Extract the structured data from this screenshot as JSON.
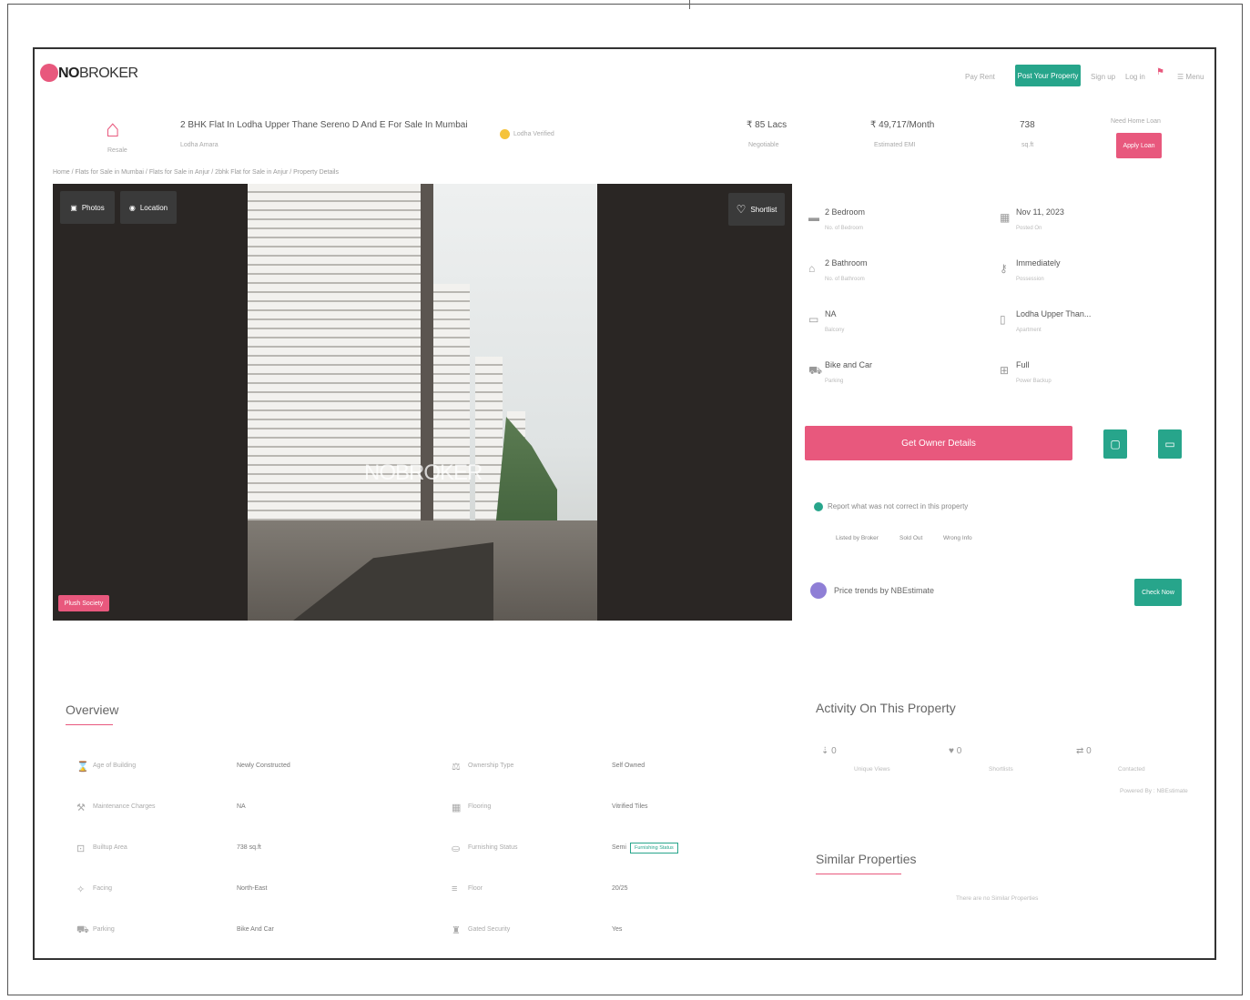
{
  "header": {
    "logo_prefix": "NO",
    "logo_suffix": "BROKER",
    "nav_plans": "Pay Rent",
    "post_property": "Post Your Property",
    "sign_up": "Sign up",
    "log_in": "Log in",
    "menu": "Menu"
  },
  "summary": {
    "property_type": "Resale",
    "title": "2 BHK Flat In Lodha Upper Thane Sereno D And E For Sale In Mumbai",
    "subtitle": "Lodha Amara",
    "verified": "Lodha Verified",
    "price": "₹ 85 Lacs",
    "price_label": "Negotiable",
    "emi": "₹ 49,717/Month",
    "emi_label": "Estimated EMI",
    "area": "738",
    "area_label": "sq.ft",
    "loan_label": "Need Home Loan",
    "apply_loan": "Apply Loan"
  },
  "breadcrumb": "Home / Flats for Sale in Mumbai / Flats for Sale in Anjur / 2bhk Flat for Sale in Anjur / Property Details",
  "gallery": {
    "photos": "Photos",
    "location": "Location",
    "shortlist": "Shortlist",
    "watermark": "NOBROKER",
    "plush_society": "Plush Society"
  },
  "details": [
    {
      "icon": "bed-icon",
      "glyph": "▬",
      "value": "2 Bedroom",
      "label": "No. of Bedroom"
    },
    {
      "icon": "calendar-icon",
      "glyph": "▦",
      "value": "Nov 11, 2023",
      "label": "Posted On"
    },
    {
      "icon": "bath-icon",
      "glyph": "⌂",
      "value": "2 Bathroom",
      "label": "No. of Bathroom"
    },
    {
      "icon": "key-icon",
      "glyph": "⚷",
      "value": "Immediately",
      "label": "Possession"
    },
    {
      "icon": "balcony-icon",
      "glyph": "▭",
      "value": "NA",
      "label": "Balcony"
    },
    {
      "icon": "building-icon",
      "glyph": "▯",
      "value": "Lodha Upper Than...",
      "label": "Apartment"
    },
    {
      "icon": "car-icon",
      "glyph": "⛟",
      "value": "Bike and Car",
      "label": "Parking"
    },
    {
      "icon": "power-icon",
      "glyph": "⊞",
      "value": "Full",
      "label": "Power Backup"
    }
  ],
  "actions": {
    "owner_details": "Get Owner Details",
    "report_text": "Report what was not correct in this property",
    "tags": [
      "Listed by Broker",
      "Sold Out",
      "Wrong Info"
    ],
    "trends": "Price trends by NBEstimate",
    "check_now": "Check Now"
  },
  "overview": {
    "title": "Overview",
    "rows": [
      {
        "icon": "age-icon",
        "glyph": "⌛",
        "label": "Age of Building",
        "value": "Newly Constructed",
        "icon2": "ownership-icon",
        "glyph2": "⚖",
        "label2": "Ownership Type",
        "value2": "Self Owned"
      },
      {
        "icon": "maintenance-icon",
        "glyph": "⚒",
        "label": "Maintenance Charges",
        "value": "NA",
        "icon2": "flooring-icon",
        "glyph2": "▦",
        "label2": "Flooring",
        "value2": "Vitrified Tiles"
      },
      {
        "icon": "area-icon",
        "glyph": "⊡",
        "label": "Builtup Area",
        "value": "738 sq.ft",
        "icon2": "furnishing-icon",
        "glyph2": "⛀",
        "label2": "Furnishing Status",
        "value2": "Semi"
      },
      {
        "icon": "facing-icon",
        "glyph": "✧",
        "label": "Facing",
        "value": "North-East",
        "icon2": "floor-icon",
        "glyph2": "≡",
        "label2": "Floor",
        "value2": "20/25"
      },
      {
        "icon": "parking-icon",
        "glyph": "⛟",
        "label": "Parking",
        "value": "Bike And Car",
        "icon2": "security-icon",
        "glyph2": "♜",
        "label2": "Gated Security",
        "value2": "Yes"
      }
    ],
    "furnishing_badge": "Furnishing Status"
  },
  "activity": {
    "title": "Activity On This Property",
    "unique_views": "0",
    "unique_views_label": "Unique Views",
    "shortlists": "0",
    "shortlists_label": "Shortlists",
    "contacts": "0",
    "contacts_label": "Contacted",
    "powered_by": "Powered By : NBEstimate"
  },
  "similar": {
    "title": "Similar Properties",
    "empty": "There are no Similar Properties"
  },
  "colors": {
    "accent": "#e8587d",
    "green": "#27a58b"
  }
}
